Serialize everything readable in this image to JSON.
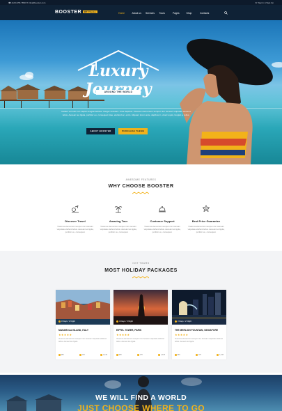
{
  "topbar": {
    "left": "☎ (123) 456 7890  ✉ info@booster.com",
    "right": "☏ Sign In  |  Sign Up"
  },
  "brand": {
    "logo": "BOOSTER",
    "badge": "WP Theme"
  },
  "nav": {
    "items": [
      "Home",
      "About us",
      "Services",
      "Tours",
      "Pages",
      "Shop",
      "Contacts"
    ],
    "active": "Home"
  },
  "hero": {
    "title": "Luxury Journey",
    "ribbon": "AROUND THE WORLD",
    "description": "Nullam vel odio non sapien feugiat facilisis. Integer tincidunt. Cras dapibus. Vivamus elementum semper nisi. Aenean vulputate eleifend tellus. Aenean leo ligula, porttitor eu, consequat vitae, eleifend ac, enim. Aliquam lorem ante, dapibus in, viverra quis, feugiat a, tellus.",
    "btn_primary": "ABOUT BOOSTER",
    "btn_secondary": "PURCHASE THEME"
  },
  "features": {
    "subtitle": "AWESOME FEATURES",
    "title": "WHY CHOOSE BOOSTER",
    "items": [
      {
        "icon": "travel-icon",
        "title": "Discover Travel",
        "desc": "Vivamus elementum semper nisi. Aenean vulputate eleifend tellus. Aenean leo ligula, porttitor eu, consequat."
      },
      {
        "icon": "palm-tree-icon",
        "title": "Amazing Tour",
        "desc": "Vivamus elementum semper nisi. Aenean vulputate eleifend tellus. Aenean leo ligula, porttitor eu, consequat."
      },
      {
        "icon": "service-bell-icon",
        "title": "Customer Support",
        "desc": "Vivamus elementum semper nisi. Aenean vulputate eleifend tellus. Aenean leo ligula, porttitor eu, consequat."
      },
      {
        "icon": "price-badge-icon",
        "title": "Best Price Guarantee",
        "desc": "Vivamus elementum semper nisi. Aenean vulputate eleifend tellus. Aenean leo ligula, porttitor eu, consequat."
      }
    ]
  },
  "packages": {
    "subtitle": "HOT TOURS",
    "title": "MOST HOLIDAY PACKAGES",
    "items": [
      {
        "tag": "3 Days / 2 Night",
        "name": "MANAROLA ISLAND, ITALY",
        "stars": "★★★★★",
        "desc": "Vivamus elementum semper nisi. Aenean vulputate eleifend tellus. Aenean leo ligula.",
        "meta": [
          "$89",
          "125",
          "1,438"
        ]
      },
      {
        "tag": "4 Days / 3 Night",
        "name": "EIFFEL TOWER, PARIS",
        "stars": "★★★★★",
        "desc": "Vivamus elementum semper nisi. Aenean vulputate eleifend tellus. Aenean leo ligula.",
        "meta": [
          "$89",
          "125",
          "1,438"
        ]
      },
      {
        "tag": "3 Days / 2 Night",
        "name": "THE MERLION FOUNTAIN, SINGAPORE",
        "stars": "★★★★★",
        "desc": "Vivamus elementum semper nisi. Aenean vulputate eleifend tellus. Aenean leo ligula.",
        "meta": [
          "$89",
          "125",
          "1,438"
        ]
      }
    ]
  },
  "banner": {
    "line1": "WE WILL FIND A WORLD",
    "line2": "JUST CHOOSE WHERE TO GO"
  },
  "colors": {
    "navy": "#0f2236",
    "accent": "#f2b21a"
  }
}
